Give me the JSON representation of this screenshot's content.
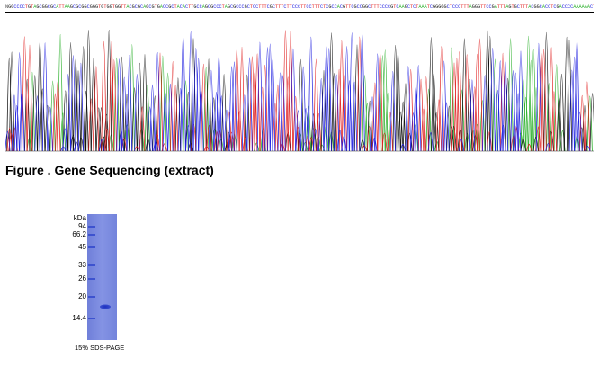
{
  "sequence_text": "NGGCCCCTGTAGCGGCGCATTAAGCGCGGCGGGTGTGGTGGTTACGCGCAGCGTGACCGCTACACTTGCCAGCGCCCTAGCGCCCGCTCCTTTCGCTTTCTTCCCTTCCTTTCTCGCCACGTTCGCCGGCTTTCCCCGTCAAGCTCTAAATCGGGGGCTCCCTTTAGGGTTCCGATTTAGTGCTTTACGGCACCTCGACCCCAAAAAACTTGATTAGG",
  "figure_caption": "Figure . Gene Sequencing (extract)",
  "gel": {
    "unit_label": "kDa",
    "markers": [
      "94",
      "66.2",
      "45",
      "33",
      "26",
      "20",
      "14.4"
    ],
    "caption": "15% SDS-PAGE"
  },
  "colors": {
    "A": "#2bb02b",
    "C": "#2020e0",
    "G": "#111111",
    "T": "#e02020",
    "gel_lane": "#7788dd",
    "gel_band": "#2a3fc9"
  }
}
